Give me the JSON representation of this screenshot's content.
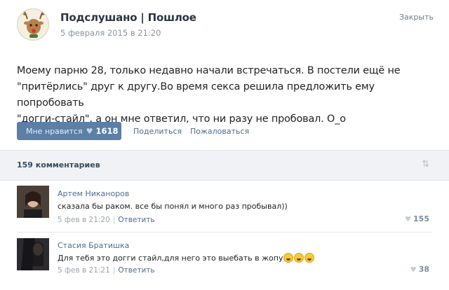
{
  "post": {
    "group_name": "Подслушано | Пошлое",
    "date": "5 февраля 2015 в 21:20",
    "close_label": "Закрыть",
    "text_line1": "Моему парню 28, только недавно начали встречаться. В постели ещё не",
    "text_line2": "\"притёрлись\" друг к другу.Во время секса решила предложить ему попробовать",
    "text_line3": "\"догги-стайл\", а он мне ответил, что ни разу не пробовал. О_о",
    "like_label": "Мне нравится",
    "like_count": "1618",
    "share_label": "Поделиться",
    "complain_label": "Пожаловаться"
  },
  "comments_header": {
    "count_label": "159 комментариев"
  },
  "comments": [
    {
      "author": "Артем Никаноров",
      "text": "сказала бы раком. все бы понял и много раз пробывал))",
      "date": "5 фев в 21:20",
      "reply_label": "Ответить",
      "likes": "155"
    },
    {
      "author": "Стасия Братишка",
      "text": "Для тебя это догги стайл,для него это выебать в жопу",
      "date": "5 фев в 21:21",
      "reply_label": "Ответить",
      "likes": "38"
    }
  ],
  "icons": {
    "like": "heart-icon",
    "sort": "sort-icon",
    "emoji": "laughing-emoji-icon",
    "avatar": "deer-avatar-icon"
  },
  "colors": {
    "like_button": "#5b7fa6",
    "link": "#4d6d91",
    "group_name": "#2b3540"
  }
}
